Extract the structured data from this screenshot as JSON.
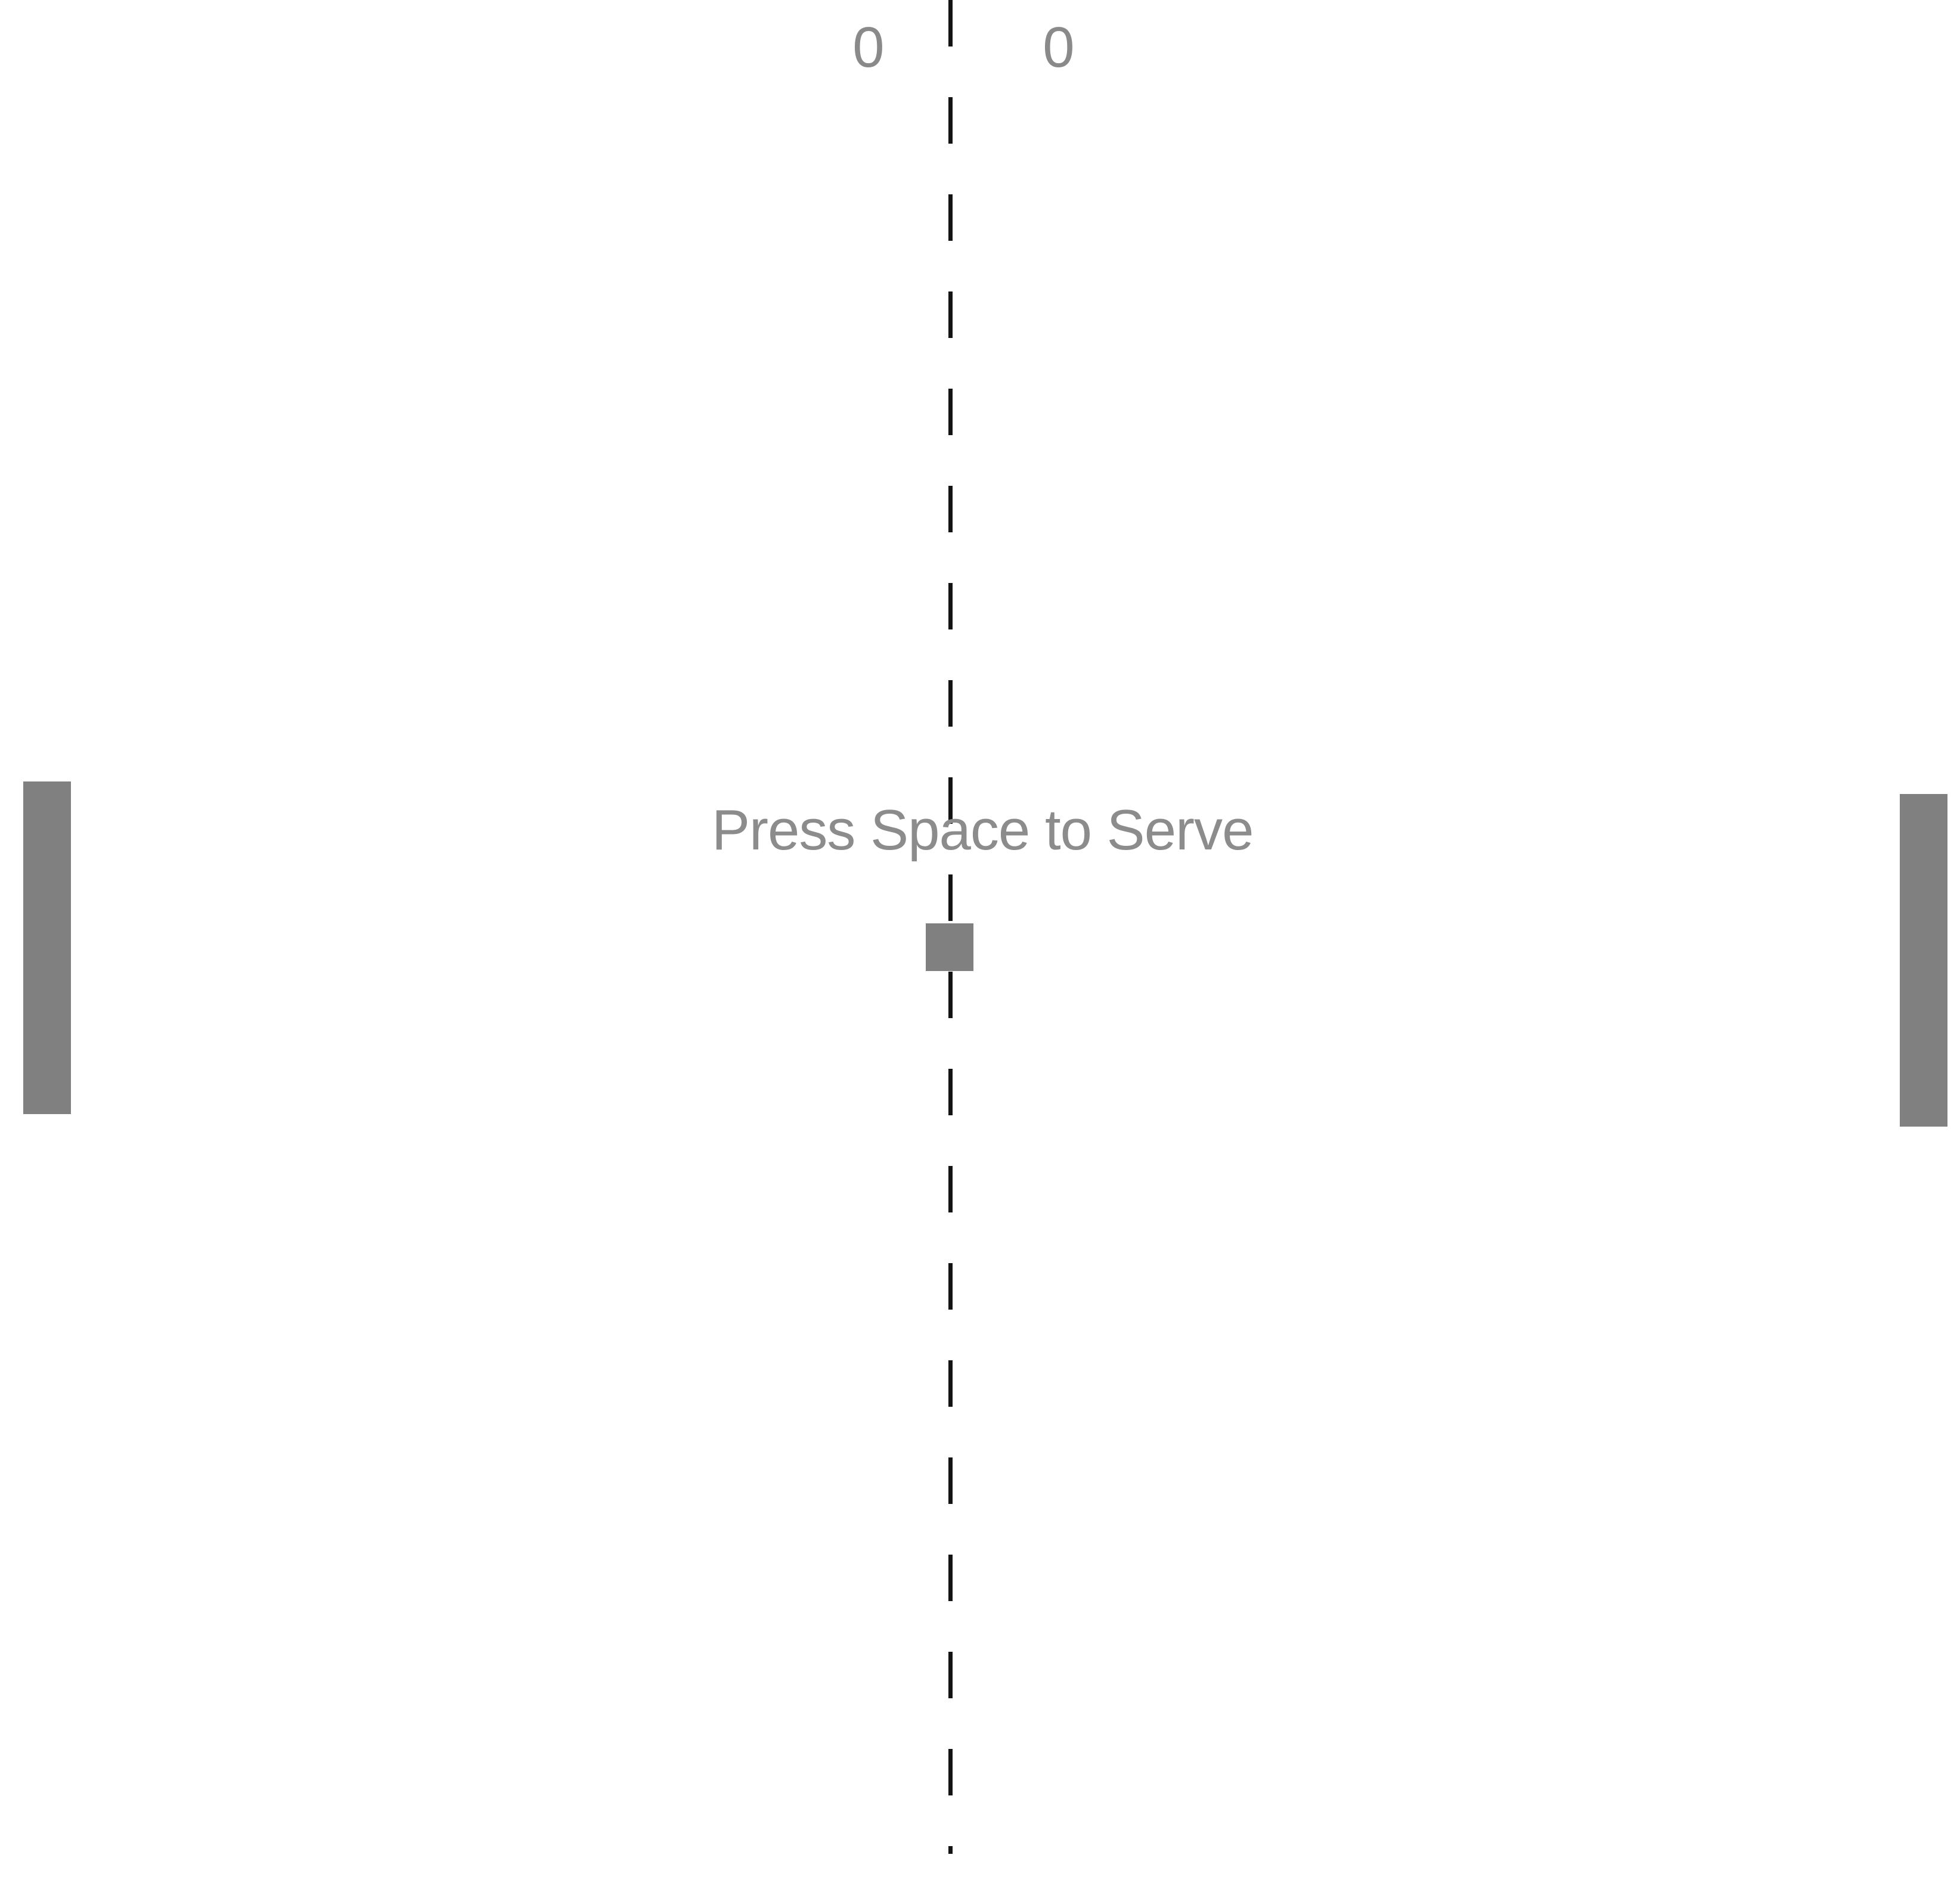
{
  "scoreboard": {
    "left_score": "0",
    "right_score": "0"
  },
  "message": "Press Space to Serve",
  "colors": {
    "background": "#ffffff",
    "paddle": "#808080",
    "ball": "#808080",
    "score_text": "#8a8a8a",
    "net": "#141414"
  }
}
